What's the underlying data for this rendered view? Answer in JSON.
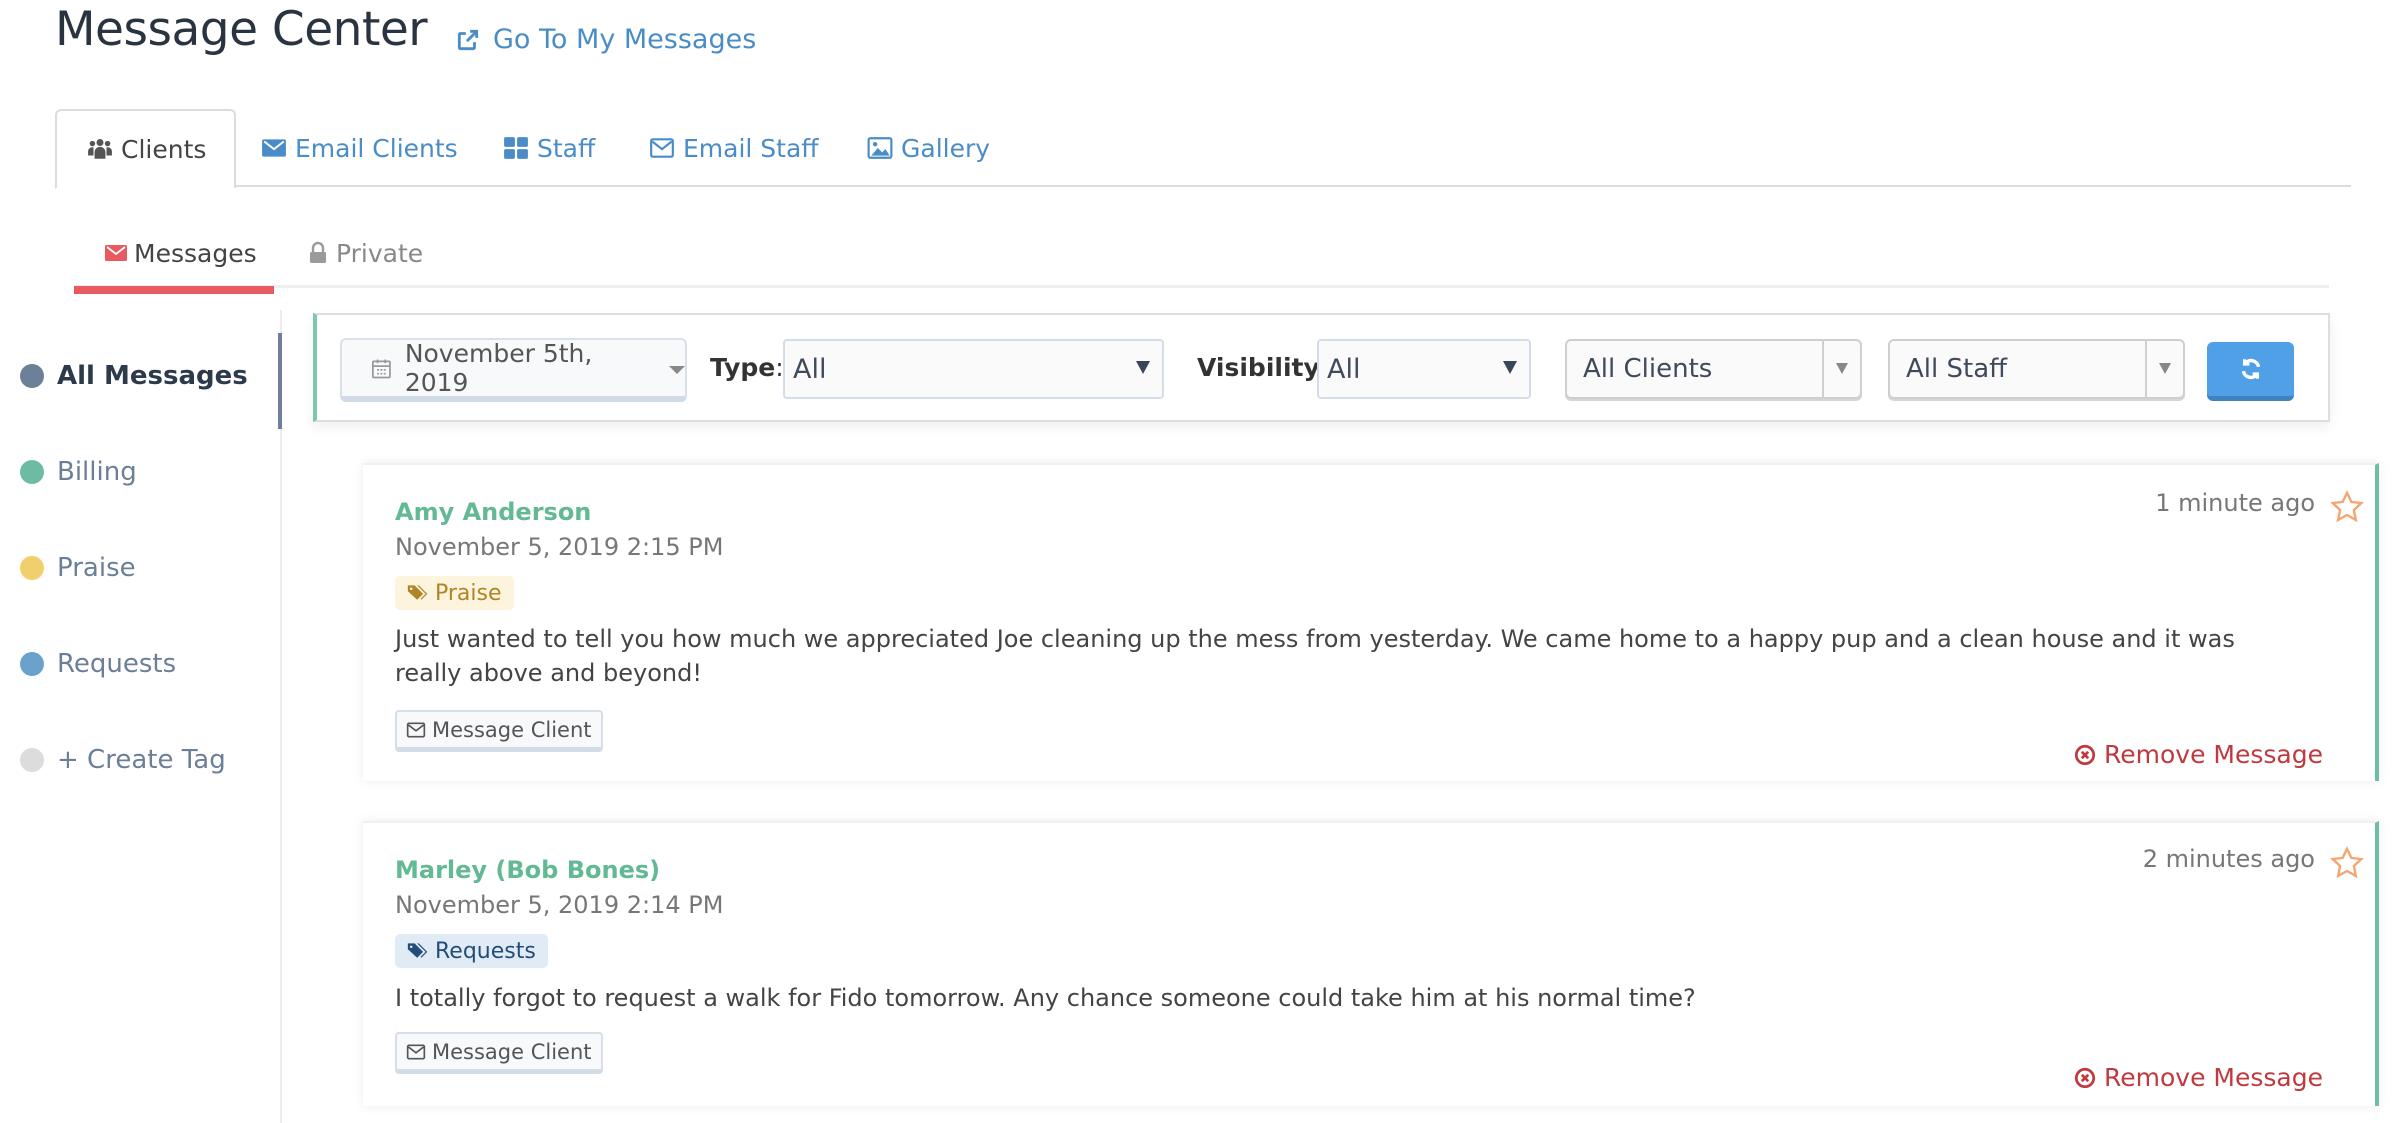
{
  "header": {
    "title": "Message Center",
    "goto_link": "Go To My Messages",
    "goto_icon": "external-link-icon"
  },
  "main_tabs": [
    {
      "label": "Clients",
      "icon": "users-icon",
      "active": true
    },
    {
      "label": "Email Clients",
      "icon": "envelope-icon",
      "active": false
    },
    {
      "label": "Staff",
      "icon": "grid-icon",
      "active": false
    },
    {
      "label": "Email Staff",
      "icon": "envelope-outline-icon",
      "active": false
    },
    {
      "label": "Gallery",
      "icon": "image-icon",
      "active": false
    }
  ],
  "sub_tabs": [
    {
      "label": "Messages",
      "icon": "envelope-icon",
      "active": true
    },
    {
      "label": "Private",
      "icon": "lock-icon",
      "active": false
    }
  ],
  "sidebar": {
    "items": [
      {
        "label": "All Messages",
        "color": "#6e7f99",
        "active": true
      },
      {
        "label": "Billing",
        "color": "#6cbba3",
        "active": false
      },
      {
        "label": "Praise",
        "color": "#f0d06a",
        "active": false
      },
      {
        "label": "Requests",
        "color": "#6aa2cc",
        "active": false
      },
      {
        "label": "+ Create Tag",
        "color": "#dcdcdc",
        "active": false
      }
    ]
  },
  "filters": {
    "date": "November 5th, 2019",
    "type_label": "Type",
    "type_value": "All",
    "visibility_label": "Visibility",
    "visibility_value": "All",
    "clients_value": "All Clients",
    "staff_value": "All Staff",
    "refresh_icon": "refresh-icon"
  },
  "messages": [
    {
      "sender": "Amy Anderson",
      "date": "November 5, 2019 2:15 PM",
      "tag": "Praise",
      "body": "Just wanted to tell you how much we appreciated Joe cleaning up the mess from yesterday. We came home to a happy pup and a clean house and it was really above and beyond!",
      "message_button": "Message Client",
      "time_ago": "1 minute ago",
      "remove_label": "Remove Message"
    },
    {
      "sender": "Marley (Bob Bones)",
      "date": "November 5, 2019 2:14 PM",
      "tag": "Requests",
      "body": "I totally forgot to request a walk for Fido tomorrow. Any chance someone could take him at his normal time?",
      "message_button": "Message Client",
      "time_ago": "2 minutes ago",
      "remove_label": "Remove Message"
    }
  ],
  "colors": {
    "accent_blue": "#4a8cc7",
    "active_red": "#e85a60",
    "sender_green": "#62b993",
    "remove_red": "#c0393f",
    "star_orange": "#f4a571",
    "refresh_blue": "#50a0e8"
  }
}
